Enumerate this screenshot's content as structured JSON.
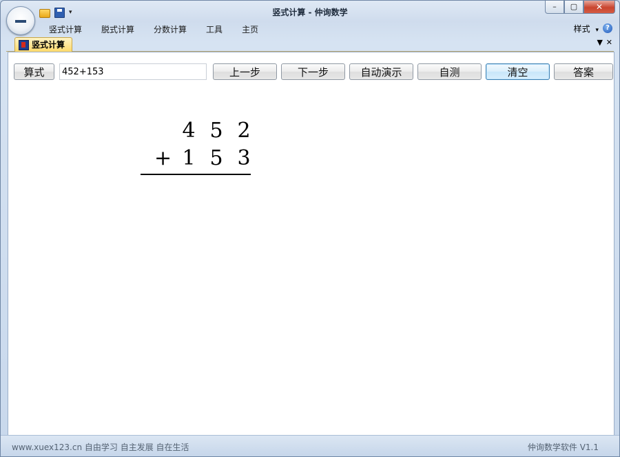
{
  "window": {
    "title": "竖式计算 - 仲询数学"
  },
  "quick_access": {
    "icons": [
      "open-folder-icon",
      "save-icon",
      "customize-dropdown-icon"
    ]
  },
  "menu": {
    "items": [
      {
        "label": "竖式计算"
      },
      {
        "label": "脱式计算"
      },
      {
        "label": "分数计算"
      },
      {
        "label": "工具"
      },
      {
        "label": "主页"
      }
    ],
    "style_label": "样式",
    "help": "?"
  },
  "document_tab": {
    "label": "竖式计算"
  },
  "toolbar": {
    "formula_label": "算式",
    "formula_value": "452+153",
    "prev_step": "上一步",
    "next_step": "下一步",
    "auto_demo": "自动演示",
    "self_test": "自测",
    "clear": "清空",
    "answer": "答案"
  },
  "calculation": {
    "top_digits": [
      "4",
      "5",
      "2"
    ],
    "operator": "+",
    "bottom_digits": [
      "1",
      "5",
      "3"
    ]
  },
  "status": {
    "left": "www.xuex123.cn 自由学习 自主发展 自在生活",
    "right": "仲询数学软件 V1.1"
  }
}
